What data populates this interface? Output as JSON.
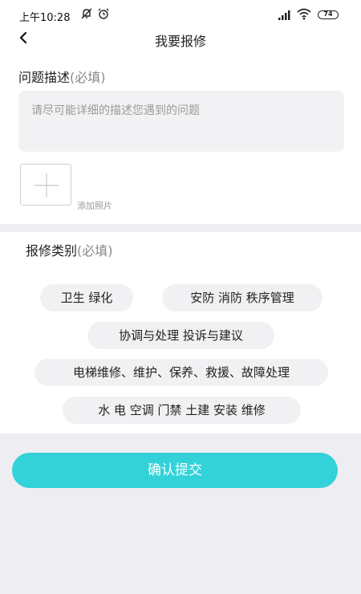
{
  "status_bar": {
    "time": "上午10:28",
    "battery": "74",
    "icons": [
      "mute-icon",
      "alarm-icon",
      "signal-icon",
      "wifi-icon",
      "battery-icon"
    ]
  },
  "header": {
    "back_icon": "chevron-left-icon",
    "title": "我要报修"
  },
  "description": {
    "label": "问题描述",
    "required_label": "(必填)",
    "placeholder": "请尽可能详细的描述您遇到的问题",
    "value": ""
  },
  "photo": {
    "add_icon": "plus-icon",
    "caption": "添加照片"
  },
  "category": {
    "label": "报修类别",
    "required_label": "(必填)",
    "options": [
      "卫生 绿化",
      "安防 消防 秩序管理",
      "协调与处理 投诉与建议",
      "电梯维修、维护、保养、救援、故障处理",
      "水 电 空调 门禁 土建 安装 维修"
    ]
  },
  "submit": {
    "label": "确认提交"
  },
  "colors": {
    "accent": "#32d2d8",
    "chip_bg": "#f1f1f3",
    "page_bg": "#eeeef2"
  }
}
